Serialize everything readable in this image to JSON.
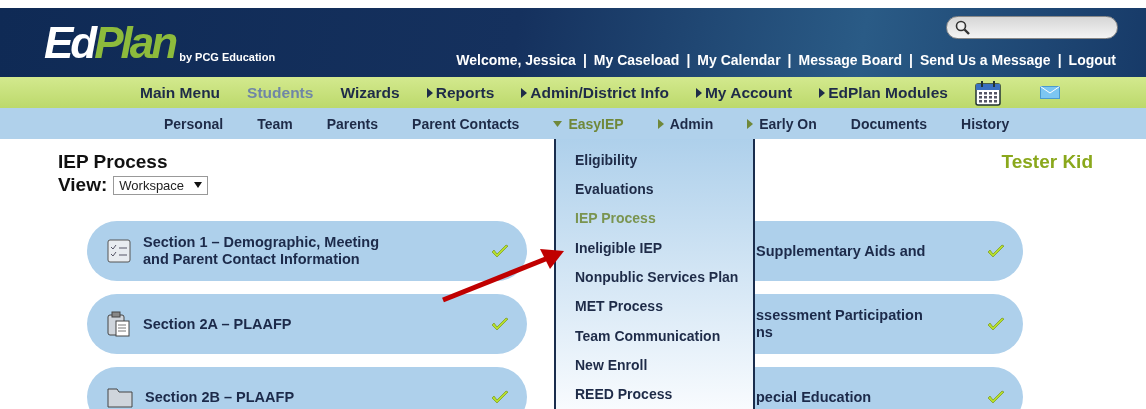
{
  "header": {
    "logo": {
      "first": "Ed",
      "second": "Plan",
      "tagline": "by PCG Education"
    },
    "welcome": "Welcome, Jessica",
    "separator": "|",
    "links": [
      "My Caseload",
      "My Calendar",
      "Message Board",
      "Send Us a Message",
      "Logout"
    ]
  },
  "main_nav": [
    {
      "label": "Main Menu",
      "arrow": false,
      "selected": false
    },
    {
      "label": "Students",
      "arrow": false,
      "selected": true
    },
    {
      "label": "Wizards",
      "arrow": false,
      "selected": false
    },
    {
      "label": "Reports",
      "arrow": true,
      "selected": false
    },
    {
      "label": "Admin/District Info",
      "arrow": true,
      "selected": false
    },
    {
      "label": "My Account",
      "arrow": true,
      "selected": false
    },
    {
      "label": "EdPlan Modules",
      "arrow": true,
      "selected": false
    }
  ],
  "sub_nav": [
    {
      "label": "Personal",
      "submenu": false,
      "expanded": false,
      "selected": false
    },
    {
      "label": "Team",
      "submenu": false,
      "expanded": false,
      "selected": false
    },
    {
      "label": "Parents",
      "submenu": false,
      "expanded": false,
      "selected": false
    },
    {
      "label": "Parent Contacts",
      "submenu": false,
      "expanded": false,
      "selected": false
    },
    {
      "label": "EasyIEP",
      "submenu": true,
      "expanded": true,
      "selected": true
    },
    {
      "label": "Admin",
      "submenu": true,
      "expanded": false,
      "selected": false
    },
    {
      "label": "Early On",
      "submenu": true,
      "expanded": false,
      "selected": false
    },
    {
      "label": "Documents",
      "submenu": false,
      "expanded": false,
      "selected": false
    },
    {
      "label": "History",
      "submenu": false,
      "expanded": false,
      "selected": false
    }
  ],
  "page": {
    "title": "IEP Process",
    "view_label": "View:",
    "view_value": "Workspace",
    "student": "Tester Kid"
  },
  "sections": [
    {
      "left": {
        "kind": "checklist",
        "title": "Section 1 – Demographic, Meeting and Parent Contact Information",
        "done": true
      },
      "right": {
        "title": "Supplementary Aids and",
        "done": true
      }
    },
    {
      "left": {
        "kind": "clipboard",
        "title": "Section 2A – PLAAFP",
        "done": true
      },
      "right": {
        "title": "ssessment Participation\nns",
        "done": true
      }
    },
    {
      "left": {
        "kind": "folder",
        "title": "Section 2B – PLAAFP",
        "done": true
      },
      "right": {
        "title": "pecial Education",
        "done": true
      }
    }
  ],
  "dropdown": [
    {
      "label": "Eligibility",
      "selected": false
    },
    {
      "label": "Evaluations",
      "selected": false
    },
    {
      "label": "IEP Process",
      "selected": true
    },
    {
      "label": "Ineligible IEP",
      "selected": false
    },
    {
      "label": "Nonpublic Services Plan",
      "selected": false
    },
    {
      "label": "MET Process",
      "selected": false
    },
    {
      "label": "Team Communication",
      "selected": false
    },
    {
      "label": "New Enroll",
      "selected": false
    },
    {
      "label": "REED Process",
      "selected": false
    }
  ]
}
